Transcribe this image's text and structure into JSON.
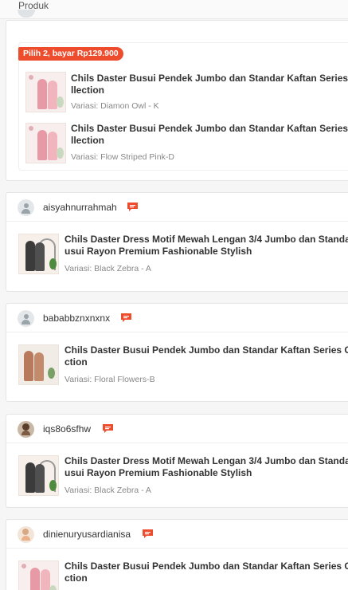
{
  "table_header": {
    "product_column": "Produk"
  },
  "colors": {
    "accent": "#ee4d2d",
    "chat_icon": "#ee4d2d"
  },
  "bundle": {
    "promo_label": "Pilih 2, bayar Rp129.900",
    "items": [
      {
        "title": "Chils Daster Busui Pendek Jumbo dan Standar Kaftan Series Co",
        "title_line2": "llection",
        "variant": "Variasi: Diamon Owl - K"
      },
      {
        "title": "Chils Daster Busui Pendek Jumbo dan Standar Kaftan Series Co",
        "title_line2": "llection",
        "variant": "Variasi: Flow Striped Pink-D"
      }
    ]
  },
  "reviews": [
    {
      "username": "aisyahnurrahmah",
      "product": {
        "title": "Chils Daster Dress Motif Mewah Lengan 3/4 Jumbo dan Standar B",
        "title_line2": "usui Rayon Premium Fashionable Stylish",
        "variant": "Variasi: Black Zebra - A"
      }
    },
    {
      "username": "bababbznxnxnx",
      "product": {
        "title": "Chils Daster Busui Pendek Jumbo dan Standar Kaftan Series Colle",
        "title_line2": "ction",
        "variant": "Variasi: Floral Flowers-B"
      }
    },
    {
      "username": "iqs8o6sfhw",
      "product": {
        "title": "Chils Daster Dress Motif Mewah Lengan 3/4 Jumbo dan Standar B",
        "title_line2": "usui Rayon Premium Fashionable Stylish",
        "variant": "Variasi: Black Zebra - A"
      }
    },
    {
      "username": "dinienuryusardianisa",
      "product": {
        "title": "Chils Daster Busui Pendek Jumbo dan Standar Kaftan Series Colle",
        "title_line2": "ction",
        "variant": ""
      }
    }
  ]
}
